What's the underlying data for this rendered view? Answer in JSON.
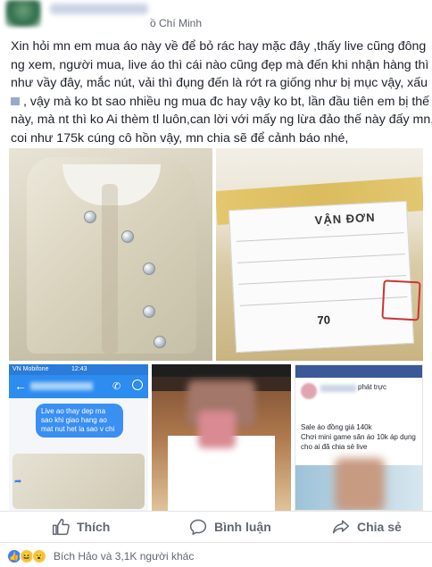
{
  "header": {
    "location": "ồ Chí Minh"
  },
  "post": {
    "lines": [
      "Xin hỏi mn em mua áo này về để bỏ rác hay mặc đây ,thấy live cũng đông",
      "ng xem, người mua, live áo thì cái nào cũng đẹp mà đến khi nhận hàng thì",
      "như vầy đây, mắc nút, vải thì đụng đến là rớt ra giống như bị mục vậy, xấu",
      ", vậy mà ko bt sao nhiều ng mua đc hay vậy ko bt, lần đầu tiên em bị thế",
      "này, mà nt thì ko Ai thèm tl luôn,can lời với mấy ng lừa đảo thế này đấy mn,",
      "coi như 175k cúng cô hồn vậy, mn chia sẽ để cảnh báo nhé,"
    ]
  },
  "photos": {
    "waybill_title": "VẬN ĐƠN",
    "waybill_number": "70",
    "chat_bubble": "Live ao thay dep ma sao khi giao hang ao mat nut het la sao v chi",
    "fb_live_label": "phát trực",
    "fb_post_text": "Sale áo đồng giá 140k\nChơi mini game săn áo 10k áp dụng cho ai đã chia sẻ live",
    "fb_actions": "Thích    Bình luận    Chia sẻ",
    "phone_time": "12:43",
    "phone_carrier": "VN Mobifone"
  },
  "actions": {
    "like": "Thích",
    "comment": "Bình luận",
    "share": "Chia sẻ"
  },
  "reactions": {
    "summary": "Bích Hảo và 3,1K người khác"
  },
  "colors": {
    "text": "#1d2129",
    "muted": "#616770",
    "fb_blue": "#4080ff",
    "divider": "#e5e5e5"
  }
}
